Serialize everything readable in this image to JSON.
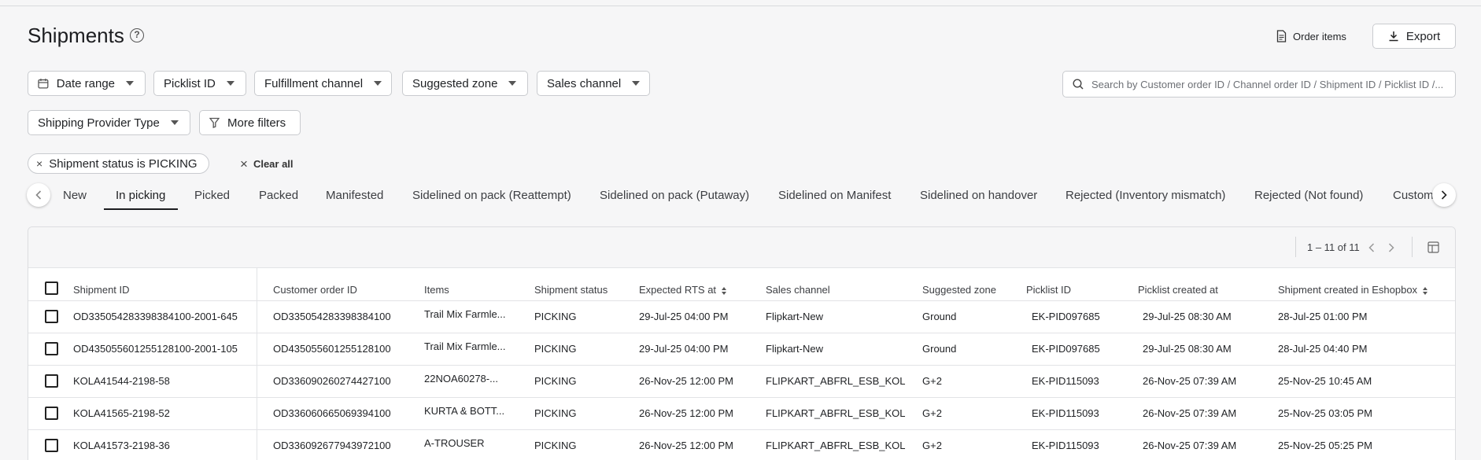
{
  "page": {
    "title": "Shipments"
  },
  "header": {
    "order_items_label": "Order items",
    "export_label": "Export"
  },
  "filters": [
    {
      "label": "Date range",
      "icon": "calendar-icon"
    },
    {
      "label": "Picklist ID"
    },
    {
      "label": "Fulfillment channel"
    },
    {
      "label": "Suggested zone"
    },
    {
      "label": "Sales channel"
    }
  ],
  "filters_row2": {
    "shipping_provider": "Shipping Provider Type",
    "more_filters": "More filters"
  },
  "search": {
    "placeholder": "Search by Customer order ID / Channel order ID / Shipment ID / Picklist ID /..."
  },
  "active_filter": {
    "chip_label": "Shipment status is PICKING",
    "clear_all": "Clear all"
  },
  "tabs": [
    "New",
    "In picking",
    "Picked",
    "Packed",
    "Manifested",
    "Sidelined on pack (Reattempt)",
    "Sidelined on pack (Putaway)",
    "Sidelined on Manifest",
    "Sidelined on handover",
    "Rejected (Inventory mismatch)",
    "Rejected (Not found)",
    "Custom"
  ],
  "active_tab": "In picking",
  "pagination": {
    "range": "1 – 11 of 11"
  },
  "table": {
    "columns": [
      "Shipment ID",
      "Customer order ID",
      "Items",
      "Shipment status",
      "Expected RTS at",
      "Sales channel",
      "Suggested zone",
      "Picklist ID",
      "Picklist created at",
      "Shipment created in Eshopbox"
    ],
    "rows": [
      [
        "OD335054283398384100-2001-645",
        "OD335054283398384100",
        "Trail Mix Farmle...",
        "PICKING",
        "29-Jul-25 04:00 PM",
        "Flipkart-New",
        "Ground",
        "EK-PID097685",
        "29-Jul-25 08:30 AM",
        "28-Jul-25 01:00 PM"
      ],
      [
        "OD435055601255128100-2001-105",
        "OD435055601255128100",
        "Trail Mix Farmle...",
        "PICKING",
        "29-Jul-25 04:00 PM",
        "Flipkart-New",
        "Ground",
        "EK-PID097685",
        "29-Jul-25 08:30 AM",
        "28-Jul-25 04:40 PM"
      ],
      [
        "KOLA41544-2198-58",
        "OD336090260274427100",
        "22NOA60278-...",
        "PICKING",
        "26-Nov-25 12:00 PM",
        "FLIPKART_ABFRL_ESB_KOL",
        "G+2",
        "EK-PID115093",
        "26-Nov-25 07:39 AM",
        "25-Nov-25 10:45 AM"
      ],
      [
        "KOLA41565-2198-52",
        "OD336060665069394100",
        "KURTA & BOTT...",
        "PICKING",
        "26-Nov-25 12:00 PM",
        "FLIPKART_ABFRL_ESB_KOL",
        "G+2",
        "EK-PID115093",
        "26-Nov-25 07:39 AM",
        "25-Nov-25 03:05 PM"
      ],
      [
        "KOLA41573-2198-36",
        "OD336092677943972100",
        "A-TROUSER",
        "PICKING",
        "26-Nov-25 12:00 PM",
        "FLIPKART_ABFRL_ESB_KOL",
        "G+2",
        "EK-PID115093",
        "26-Nov-25 07:39 AM",
        "25-Nov-25 05:25 PM"
      ]
    ]
  }
}
